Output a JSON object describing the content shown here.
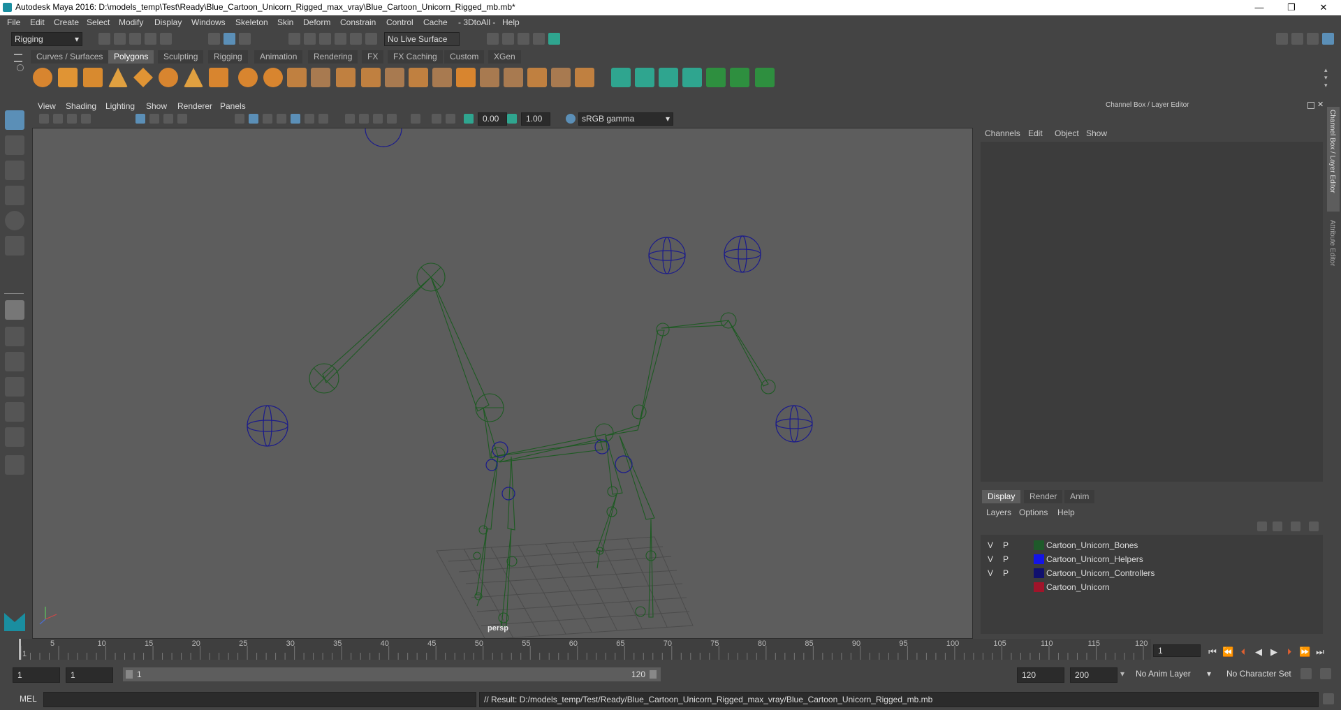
{
  "window": {
    "title": "Autodesk Maya 2016: D:\\models_temp\\Test\\Ready\\Blue_Cartoon_Unicorn_Rigged_max_vray\\Blue_Cartoon_Unicorn_Rigged_mb.mb*",
    "minimize": "—",
    "restore": "❐",
    "close": "✕"
  },
  "menubar": {
    "items": [
      "File",
      "Edit",
      "Create",
      "Select",
      "Modify",
      "Display",
      "Windows",
      "Skeleton",
      "Skin",
      "Deform",
      "Constrain",
      "Control",
      "Cache",
      "- 3DtoAll -",
      "Help"
    ]
  },
  "statusline": {
    "menuset": "Rigging",
    "live_surface": "No Live Surface"
  },
  "shelf": {
    "tabs": [
      "Curves / Surfaces",
      "Polygons",
      "Sculpting",
      "Rigging",
      "Animation",
      "Rendering",
      "FX",
      "FX Caching",
      "Custom",
      "XGen"
    ],
    "active": "Polygons"
  },
  "panel": {
    "menus": [
      "View",
      "Shading",
      "Lighting",
      "Show",
      "Renderer",
      "Panels"
    ],
    "exposure": "0.00",
    "gamma": "1.00",
    "color_space": "sRGB gamma",
    "camera_label": "persp"
  },
  "channelbox": {
    "title": "Channel Box / Layer Editor",
    "menus": [
      "Channels",
      "Edit",
      "Object",
      "Show"
    ]
  },
  "layers": {
    "tabs": [
      "Display",
      "Render",
      "Anim"
    ],
    "active_tab": "Display",
    "menus": [
      "Layers",
      "Options",
      "Help"
    ],
    "rows": [
      {
        "v": "V",
        "p": "P",
        "name": "Cartoon_Unicorn_Bones",
        "color": "#1e5a2a"
      },
      {
        "v": "V",
        "p": "P",
        "name": "Cartoon_Unicorn_Helpers",
        "color": "#1414e6"
      },
      {
        "v": "V",
        "p": "P",
        "name": "Cartoon_Unicorn_Controllers",
        "color": "#10106e"
      },
      {
        "v": "",
        "p": "",
        "name": "Cartoon_Unicorn",
        "color": "#a0142a"
      }
    ]
  },
  "sidetabs": {
    "channel": "Channel Box / Layer Editor",
    "attribute": "Attribute Editor"
  },
  "timeline": {
    "ticks": [
      "1",
      "5",
      "10",
      "15",
      "20",
      "25",
      "30",
      "35",
      "40",
      "45",
      "50",
      "55",
      "60",
      "65",
      "70",
      "75",
      "80",
      "85",
      "90",
      "95",
      "100",
      "105",
      "110",
      "115",
      "120"
    ],
    "current_frame": "1"
  },
  "range": {
    "start": "1",
    "playback_start": "1",
    "range_start_label": "1",
    "range_end_label": "120",
    "playback_end": "120",
    "end": "200",
    "anim_layer": "No Anim Layer",
    "character_set": "No Character Set"
  },
  "cmdline": {
    "mode": "MEL",
    "result": "// Result: D:/models_temp/Test/Ready/Blue_Cartoon_Unicorn_Rigged_max_vray/Blue_Cartoon_Unicorn_Rigged_mb.mb"
  },
  "colors": {
    "bone": "#1d5a22",
    "helper": "#1a1a8c",
    "grid": "#4a4a4a"
  }
}
